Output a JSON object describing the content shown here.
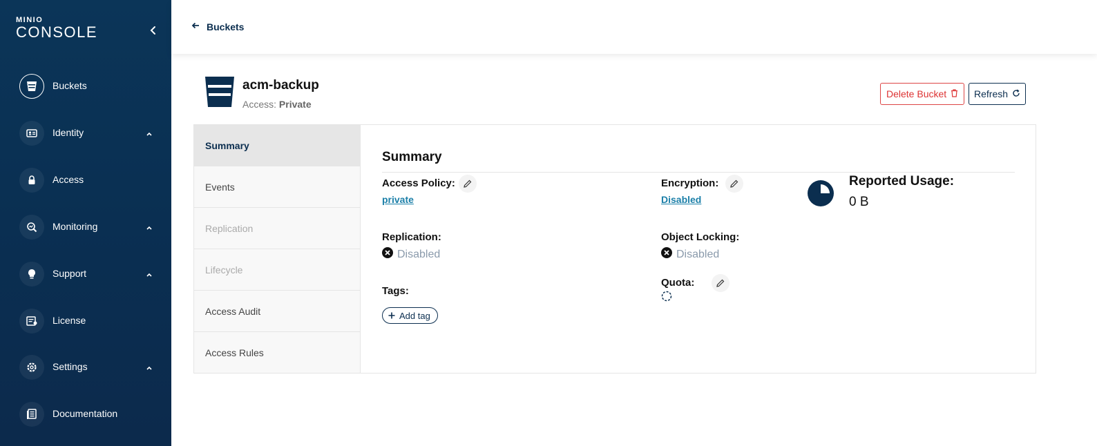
{
  "brand": {
    "top": "MINIO",
    "main": "CONSOLE"
  },
  "sidebar": {
    "items": [
      {
        "label": "Buckets",
        "icon": "bucket-icon"
      },
      {
        "label": "Identity",
        "icon": "id-card-icon"
      },
      {
        "label": "Access",
        "icon": "lock-icon"
      },
      {
        "label": "Monitoring",
        "icon": "magnifier-chart-icon"
      },
      {
        "label": "Support",
        "icon": "lightbulb-icon"
      },
      {
        "label": "License",
        "icon": "license-icon"
      },
      {
        "label": "Settings",
        "icon": "gear-icon"
      },
      {
        "label": "Documentation",
        "icon": "document-icon"
      }
    ]
  },
  "topbar": {
    "back_label": "Buckets"
  },
  "bucket": {
    "name": "acm-backup",
    "access_prefix": "Access:",
    "access_value": "Private"
  },
  "actions": {
    "delete_label": "Delete Bucket",
    "refresh_label": "Refresh"
  },
  "tabs": [
    "Summary",
    "Events",
    "Replication",
    "Lifecycle",
    "Access Audit",
    "Access Rules"
  ],
  "summary": {
    "title": "Summary",
    "access_policy_label": "Access Policy:",
    "access_policy_value": "private",
    "encryption_label": "Encryption:",
    "encryption_value": "Disabled",
    "replication_label": "Replication:",
    "replication_value": "Disabled",
    "object_locking_label": "Object Locking:",
    "object_locking_value": "Disabled",
    "tags_label": "Tags:",
    "add_tag_label": "Add tag",
    "quota_label": "Quota:",
    "usage_label": "Reported Usage:",
    "usage_value": "0 B"
  },
  "colors": {
    "sidebar": "#0b3558",
    "accent_link": "#1b7fa8",
    "danger": "#dd3333",
    "navy": "#0b2e4f"
  }
}
